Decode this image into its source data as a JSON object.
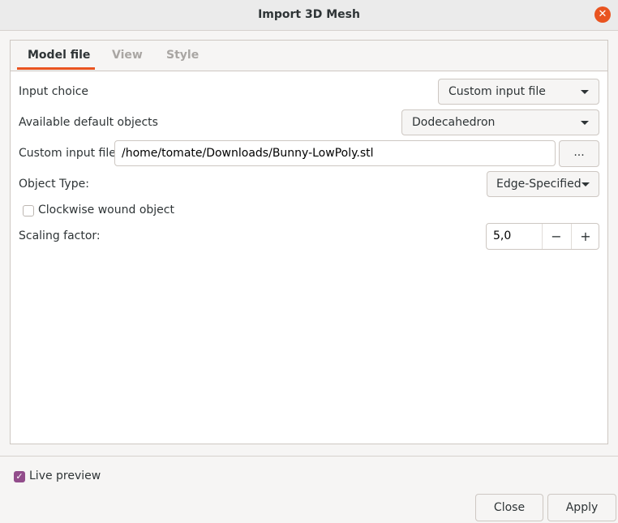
{
  "window": {
    "title": "Import 3D Mesh",
    "close_glyph": "✕"
  },
  "tabs": [
    {
      "label": "Model file",
      "active": true
    },
    {
      "label": "View",
      "active": false
    },
    {
      "label": "Style",
      "active": false
    }
  ],
  "form": {
    "input_choice": {
      "label": "Input choice",
      "value": "Custom input file"
    },
    "default_objects": {
      "label": "Available default objects",
      "value": "Dodecahedron"
    },
    "custom_file": {
      "label": "Custom input file",
      "value": "/home/tomate/Downloads/Bunny-LowPoly.stl",
      "browse_label": "..."
    },
    "object_type": {
      "label": "Object Type:",
      "value": "Edge-Specified"
    },
    "clockwise": {
      "label": "Clockwise wound object",
      "checked": false
    },
    "scaling": {
      "label": "Scaling factor:",
      "value": "5,0",
      "minus": "−",
      "plus": "+"
    }
  },
  "footer": {
    "live_preview": {
      "label": "Live preview",
      "checked": true,
      "check_glyph": "✓"
    },
    "close_label": "Close",
    "apply_label": "Apply"
  },
  "colors": {
    "accent": "#e95420",
    "checkbox_checked": "#924d8b"
  }
}
